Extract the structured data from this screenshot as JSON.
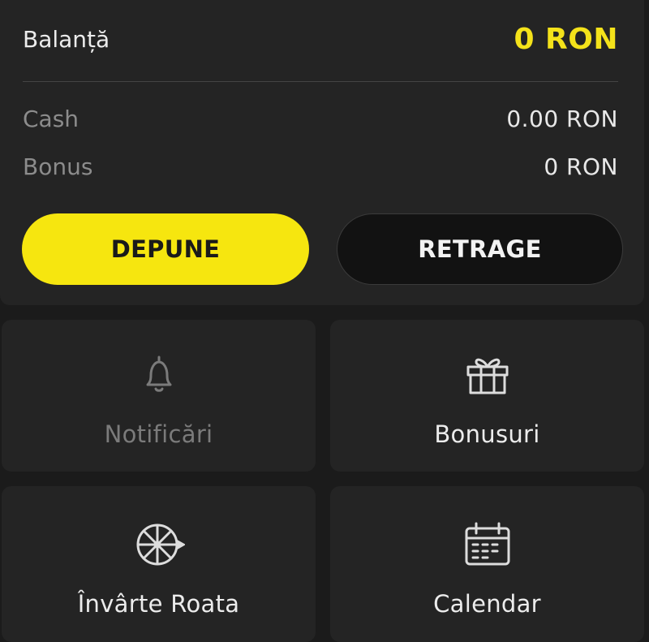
{
  "balance": {
    "label": "Balanță",
    "value": "0 RON",
    "cash_label": "Cash",
    "cash_value": "0.00 RON",
    "bonus_label": "Bonus",
    "bonus_value": "0 RON",
    "accent_color": "#f4e21a"
  },
  "actions": {
    "deposit_label": "DEPUNE",
    "withdraw_label": "RETRAGE"
  },
  "tiles": [
    {
      "label": "Notificări",
      "icon": "bell-icon",
      "state": "muted"
    },
    {
      "label": "Bonusuri",
      "icon": "gift-icon",
      "state": "active"
    },
    {
      "label": "Învârte Roata",
      "icon": "wheel-icon",
      "state": "active"
    },
    {
      "label": "Calendar",
      "icon": "calendar-icon",
      "state": "active"
    }
  ]
}
